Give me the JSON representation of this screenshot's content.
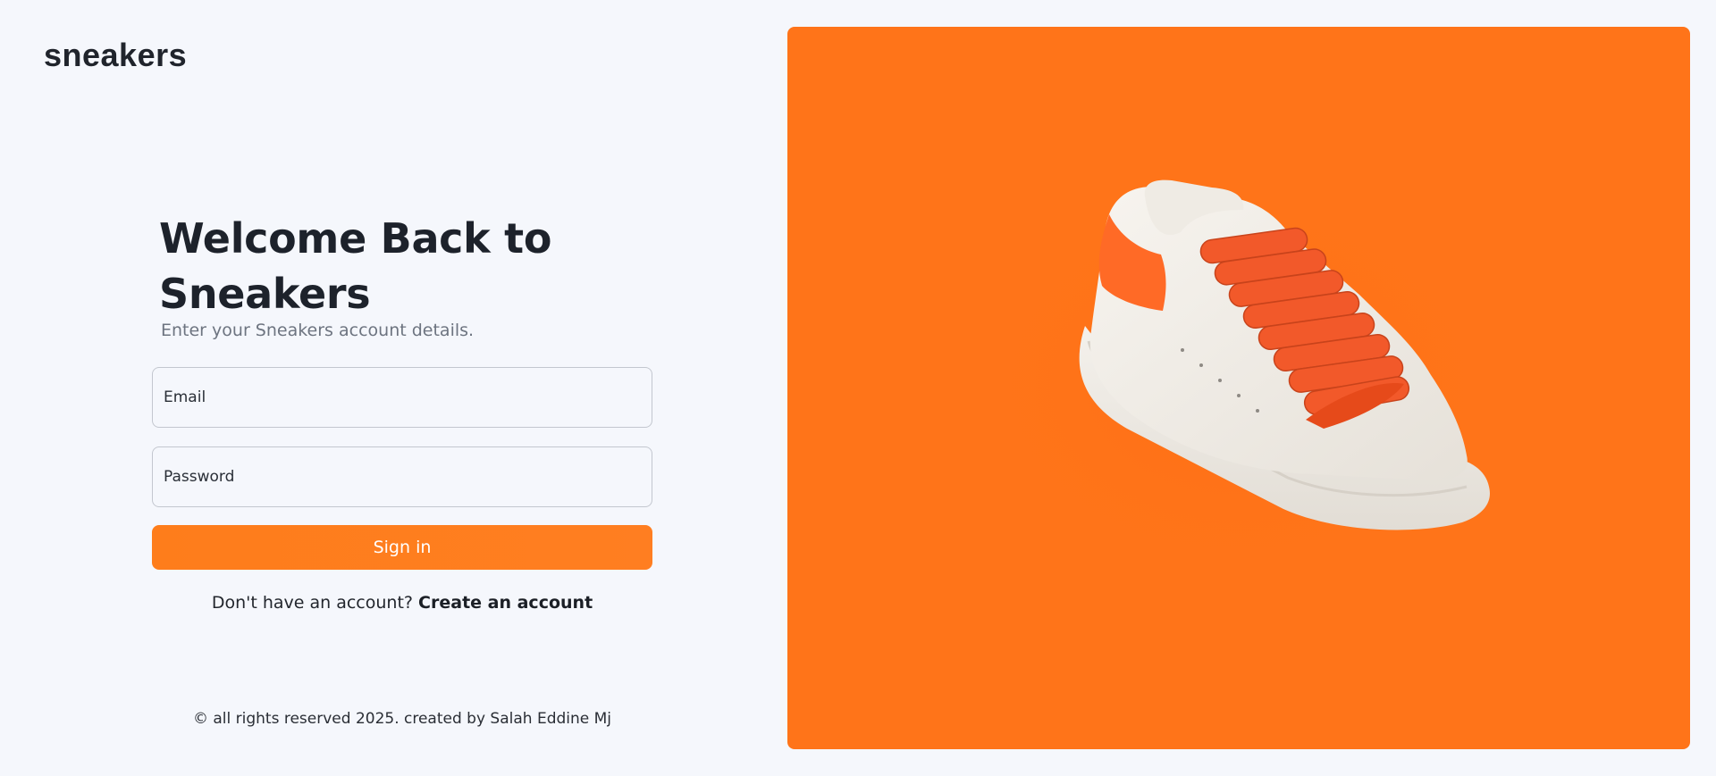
{
  "brand": {
    "logo_text": "sneakers"
  },
  "login": {
    "title": "Welcome Back to Sneakers",
    "subtitle": "Enter your Sneakers account details.",
    "email_placeholder": "Email",
    "password_placeholder": "Password",
    "signin_label": "Sign in",
    "no_account_text": "Don't have an account?",
    "create_account_label": "Create an account"
  },
  "footer": {
    "text": "© all rights reserved 2025. created by Salah Eddine Mj"
  },
  "hero": {
    "background_color": "#ff7419",
    "image_subject": "white sneaker with orange laces and heel tab"
  },
  "colors": {
    "accent": "#ff7e21",
    "page_bg": "#f5f7fc",
    "text": "#1f2329"
  }
}
